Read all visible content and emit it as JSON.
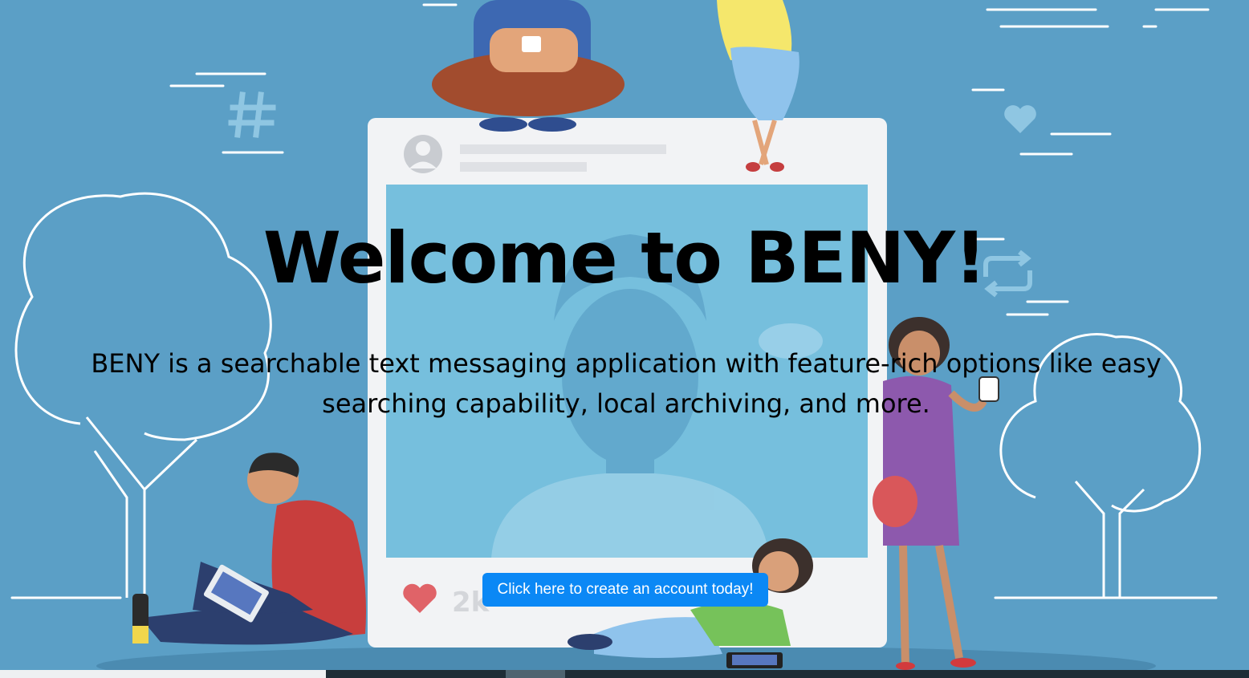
{
  "hero": {
    "title": "Welcome to BENY!",
    "description": "BENY is a searchable text messaging application with feature-rich options like easy searching capability, local archiving, and more.",
    "cta_label": "Click here to create an account today!"
  },
  "illustration": {
    "post_likes": "2k",
    "icons": [
      "hashtag-icon",
      "heart-icon",
      "repost-icon",
      "avatar-icon"
    ]
  },
  "colors": {
    "background": "#5b9fc6",
    "cta_background": "#0b88f5",
    "cta_text": "#ffffff",
    "title_text": "#000000"
  }
}
